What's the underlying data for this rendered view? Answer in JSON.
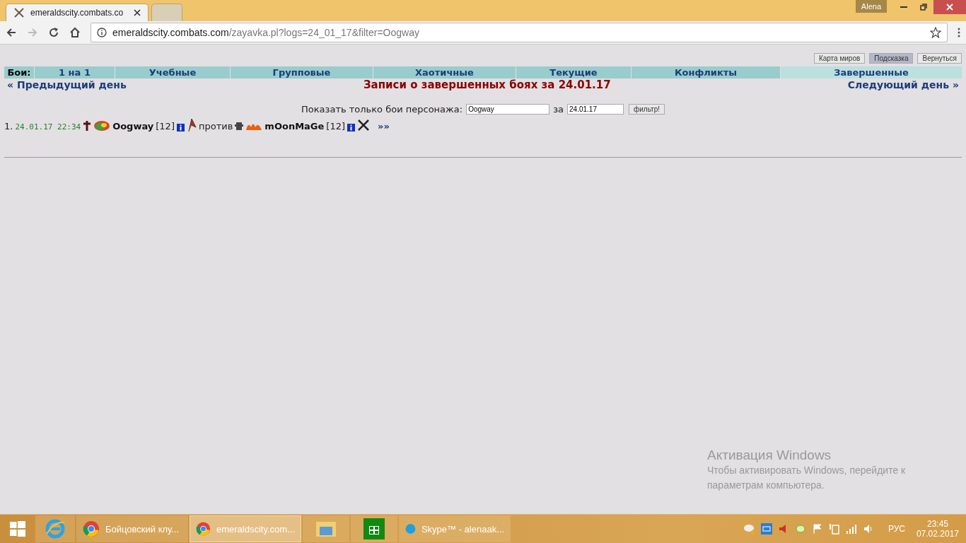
{
  "browser": {
    "tabs": [
      {
        "title": "emeraldscity.combats.co",
        "selected": true
      },
      {
        "selected": false
      }
    ],
    "profile": "Alena",
    "address": {
      "host": "emeraldscity.combats.com",
      "path": "/zayavka.pl?logs=24_01_17&filter=Oogway"
    }
  },
  "top_buttons": [
    {
      "label": "Карта миров",
      "selected": false
    },
    {
      "label": "Подсказка",
      "selected": true
    },
    {
      "label": "Вернуться",
      "selected": false
    }
  ],
  "nav": {
    "label": "Бои:",
    "items": [
      {
        "label": "1 на 1",
        "selected": false
      },
      {
        "label": "Учебные",
        "selected": false
      },
      {
        "label": "Групповые",
        "selected": false
      },
      {
        "label": "Хаотичные",
        "selected": false
      },
      {
        "label": "Текущие",
        "selected": false
      },
      {
        "label": "Конфликты",
        "selected": false
      },
      {
        "label": "Завершенные",
        "selected": true
      }
    ]
  },
  "prev_day": "« Предыдущий день",
  "heading": "Записи о завершенных боях за 24.01.17",
  "next_day": "Следующий день »",
  "filter": {
    "label": "Показать только бои персонажа:",
    "name_value": "Oogway",
    "date_label": "за",
    "date_value": "24.01.17",
    "button": "фильтр!"
  },
  "battles": [
    {
      "index": "1.",
      "datetime": "24.01.17 22:34",
      "player1": {
        "name": "Oogway",
        "level": "[12]"
      },
      "versus": "против",
      "player2": {
        "name": "mOonMaGe",
        "level": "[12]"
      },
      "link": "»»"
    }
  ],
  "activation": {
    "title": "Активация Windows",
    "text": "Чтобы активировать Windows, перейдите к параметрам компьютера."
  },
  "taskbar": {
    "items": [
      {
        "kind": "ie",
        "selected": false
      },
      {
        "kind": "chrome",
        "label": "Бойцовский клу...",
        "selected": false
      },
      {
        "kind": "chrome",
        "label": "emeraldscity.com...",
        "selected": true
      },
      {
        "kind": "folder",
        "selected": false
      },
      {
        "kind": "store",
        "selected": false
      },
      {
        "kind": "skype",
        "label": "Skype™ - alenaak...",
        "selected": false
      }
    ],
    "lang": "РУС",
    "time": "23:45",
    "date": "07.02.2017"
  }
}
